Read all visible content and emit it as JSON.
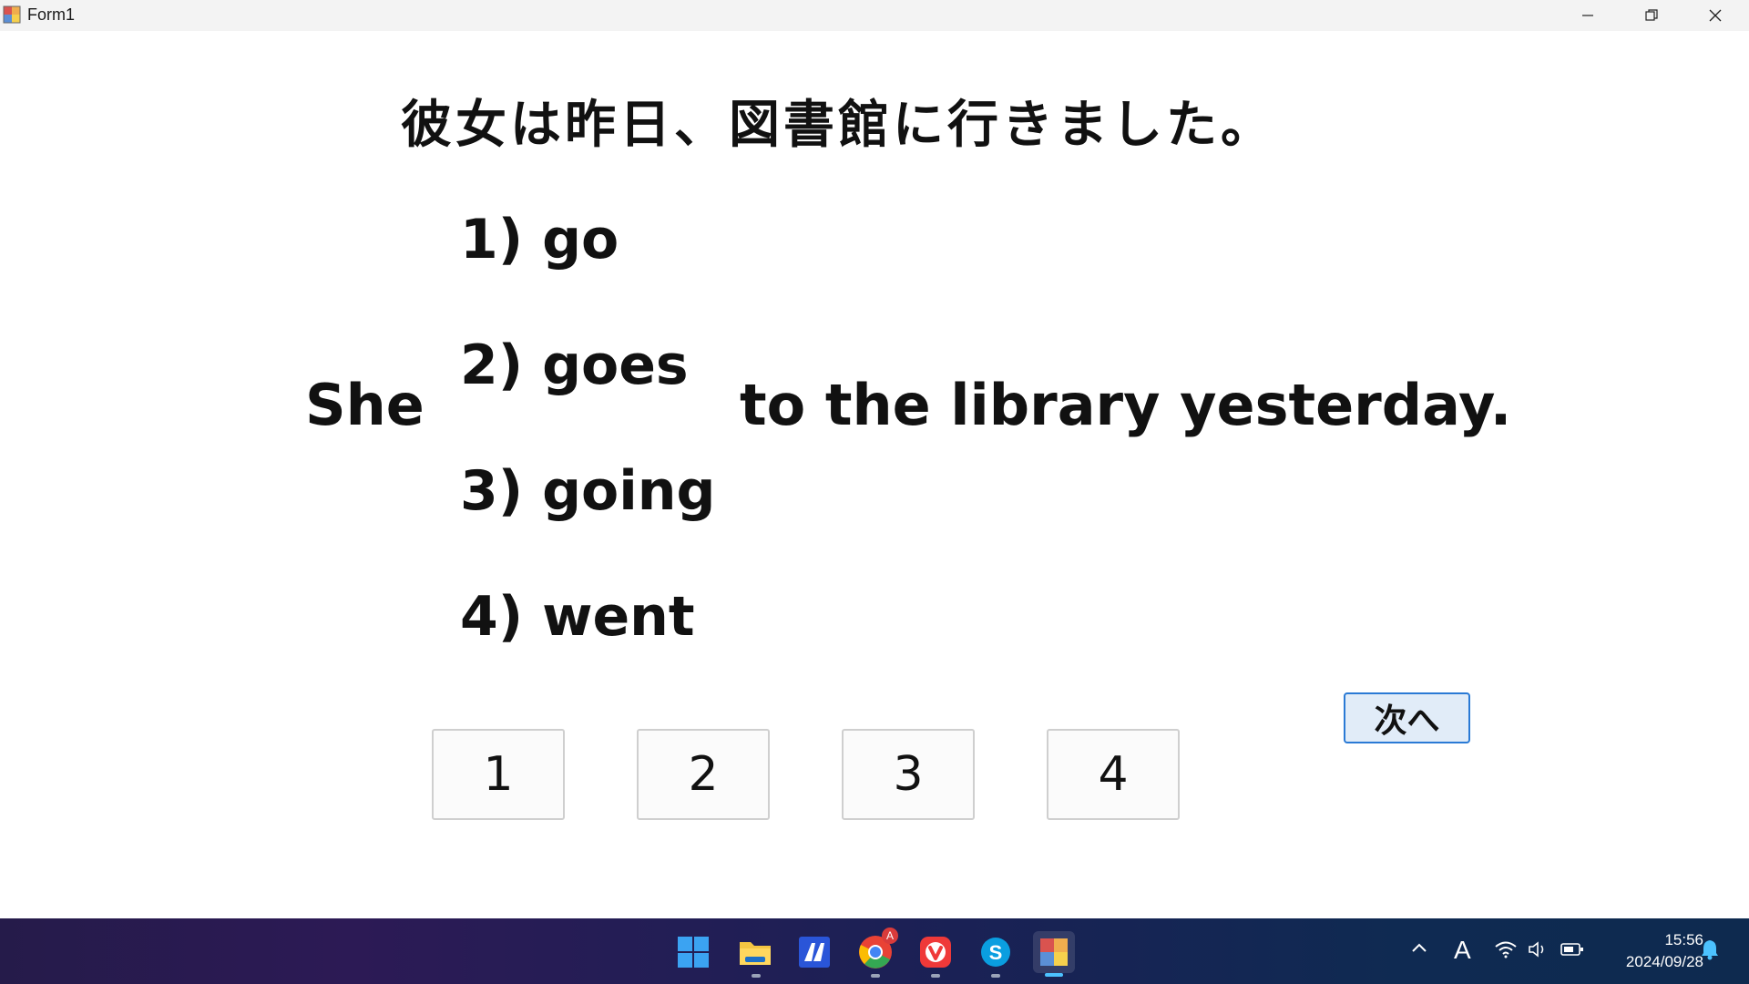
{
  "window": {
    "title": "Form1"
  },
  "question": {
    "japanese": "彼女は昨日、図書館に行きました。",
    "subject": "She",
    "rest": "to the library yesterday.",
    "options": [
      {
        "num": "1)",
        "word": "go"
      },
      {
        "num": "2)",
        "word": "goes"
      },
      {
        "num": "3)",
        "word": "going"
      },
      {
        "num": "4)",
        "word": "went"
      }
    ]
  },
  "answer_buttons": [
    "1",
    "2",
    "3",
    "4"
  ],
  "next_button": "次へ",
  "taskbar": {
    "chrome_badge": "A",
    "ime_indicator": "A",
    "time": "15:56",
    "date": "2024/09/28"
  },
  "colors": {
    "next_button_border": "#2a7ad5",
    "next_button_bg": "#e1ecf8",
    "taskbar_start": "#251b4a",
    "taskbar_end": "#0e2a4f"
  }
}
